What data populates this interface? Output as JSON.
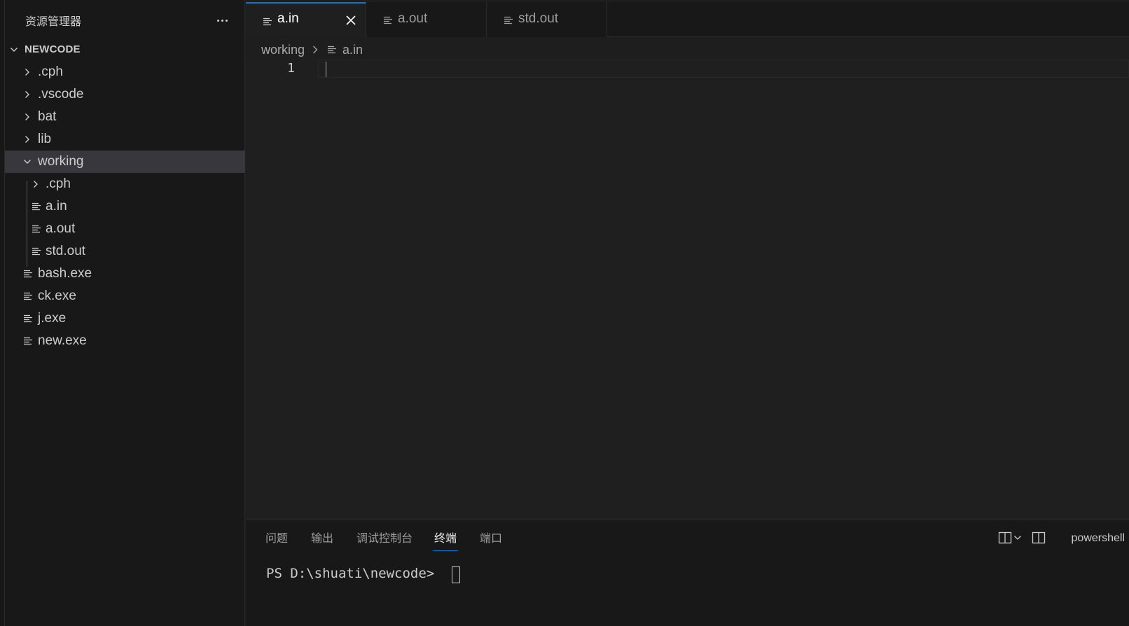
{
  "sidebar": {
    "title": "资源管理器",
    "more_icon": "ellipsis-icon",
    "root": "NEWCODE",
    "items": [
      {
        "label": ".cph",
        "kind": "folder",
        "expanded": false,
        "depth": 1
      },
      {
        "label": ".vscode",
        "kind": "folder",
        "expanded": false,
        "depth": 1
      },
      {
        "label": "bat",
        "kind": "folder",
        "expanded": false,
        "depth": 1
      },
      {
        "label": "lib",
        "kind": "folder",
        "expanded": false,
        "depth": 1
      },
      {
        "label": "working",
        "kind": "folder",
        "expanded": true,
        "depth": 1,
        "selected": true
      },
      {
        "label": ".cph",
        "kind": "folder",
        "expanded": false,
        "depth": 2
      },
      {
        "label": "a.in",
        "kind": "file",
        "depth": 2
      },
      {
        "label": "a.out",
        "kind": "file",
        "depth": 2
      },
      {
        "label": "std.out",
        "kind": "file",
        "depth": 2
      },
      {
        "label": "bash.exe",
        "kind": "file",
        "depth": 1
      },
      {
        "label": "ck.exe",
        "kind": "file",
        "depth": 1
      },
      {
        "label": "j.exe",
        "kind": "file",
        "depth": 1
      },
      {
        "label": "new.exe",
        "kind": "file",
        "depth": 1
      }
    ]
  },
  "tabs": [
    {
      "label": "a.in",
      "active": true
    },
    {
      "label": "a.out",
      "active": false
    },
    {
      "label": "std.out",
      "active": false
    }
  ],
  "breadcrumb": {
    "folder": "working",
    "file": "a.in"
  },
  "editor": {
    "line_numbers": [
      "1"
    ]
  },
  "panel": {
    "tabs": [
      {
        "label": "问题",
        "active": false
      },
      {
        "label": "输出",
        "active": false
      },
      {
        "label": "调试控制台",
        "active": false
      },
      {
        "label": "终端",
        "active": true
      },
      {
        "label": "端口",
        "active": false
      }
    ],
    "terminal_name": "powershell",
    "prompt": "PS D:\\shuati\\newcode> "
  },
  "colors": {
    "accent": "#0078d4",
    "selection": "#37373d",
    "sidebar_bg": "#181818",
    "editor_bg": "#1f1f1f"
  }
}
